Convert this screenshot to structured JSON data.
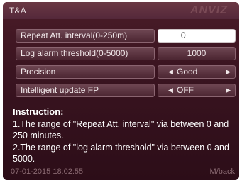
{
  "window": {
    "title": "T&A",
    "brand": "ANVIZ"
  },
  "settings": [
    {
      "label": "Repeat Att. interval(0-250m)",
      "value": "0",
      "editing": true
    },
    {
      "label": "Log alarm threshold(0-5000)",
      "value": "1000"
    },
    {
      "label": "Precision",
      "value": "Good",
      "arrows": true
    },
    {
      "label": "Intelligent update FP",
      "value": "OFF",
      "arrows": true
    }
  ],
  "instruction": {
    "title": "Instruction:",
    "lines": [
      "1.The range of \"Repeat Att. interval\" via between 0 and 250 minutes.",
      "2.The range of \"log alarm threshold\" via between 0 and 5000."
    ]
  },
  "footer": {
    "datetime": "07-01-2015 18:02:55",
    "back": "M/back"
  },
  "colors": {
    "background": "#3a1420",
    "field": "#5c3440",
    "active_field": "#ffffff"
  },
  "icons": {
    "left_arrow": "triangle-left",
    "right_arrow": "triangle-right"
  }
}
